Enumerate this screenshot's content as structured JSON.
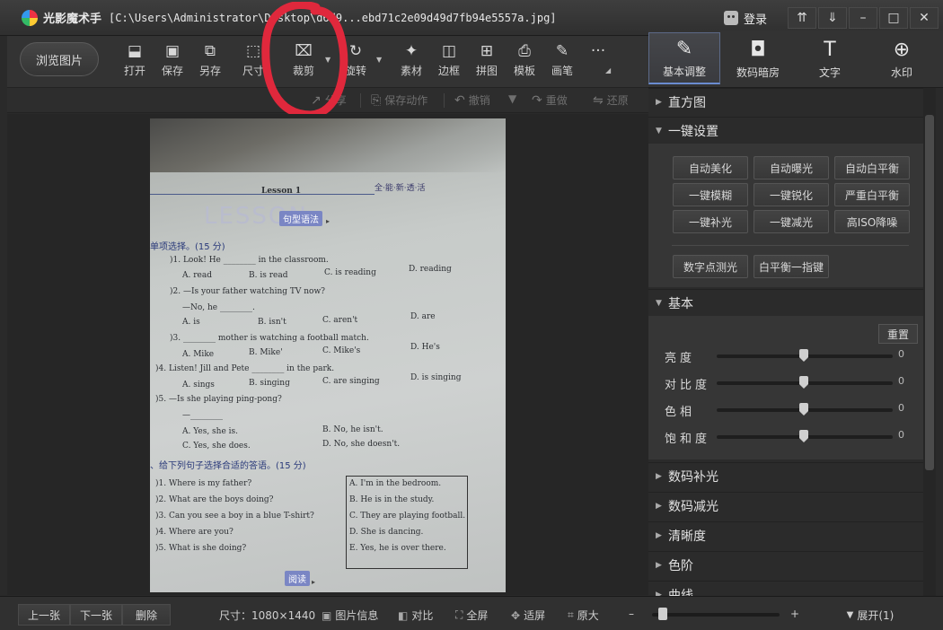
{
  "titlebar": {
    "app_name": "光影魔术手",
    "file_path": "[C:\\Users\\Administrator\\Desktop\\d6d9...ebd71c2e09d49d7fb94e5557a.jpg]",
    "login_label": "登录",
    "window_buttons": [
      "⇈",
      "⇓",
      "–",
      "□",
      "✕"
    ]
  },
  "toolbar": {
    "browse_label": "浏览图片",
    "tools": [
      {
        "label": "打开",
        "icon": "open-icon",
        "glyph": "⬓"
      },
      {
        "label": "保存",
        "icon": "save-icon",
        "glyph": "▣"
      },
      {
        "label": "另存",
        "icon": "save-as-icon",
        "glyph": "⧉"
      },
      {
        "label": "尺寸",
        "icon": "resize-icon",
        "glyph": "⬚"
      },
      {
        "label": "裁剪",
        "icon": "crop-icon",
        "glyph": "⌧"
      },
      {
        "label": "旋转",
        "icon": "rotate-icon",
        "glyph": "↻"
      },
      {
        "label": "素材",
        "icon": "material-icon",
        "glyph": "✦"
      },
      {
        "label": "边框",
        "icon": "border-icon",
        "glyph": "◫"
      },
      {
        "label": "拼图",
        "icon": "collage-icon",
        "glyph": "⊞"
      },
      {
        "label": "模板",
        "icon": "template-icon",
        "glyph": "⎙"
      },
      {
        "label": "画笔",
        "icon": "brush-icon",
        "glyph": "✎"
      },
      {
        "label": "",
        "icon": "more-icon",
        "glyph": "···"
      }
    ],
    "annotation_color": "#e0283c"
  },
  "actionbar": {
    "share": "分享",
    "save_action": "保存动作",
    "undo": "撤销",
    "redo": "重做",
    "restore": "还原"
  },
  "photo": {
    "lesson": "Lesson 1",
    "series": "全·能·新·透·活",
    "grammar_badge": "句型语法",
    "watermark": "LESSON",
    "part1": "单项选择。(15 分)",
    "q1": ")1. Look! He ________ in the classroom.",
    "q1_opts": [
      "A. read",
      "B. is read",
      "C. is reading",
      "D. reading"
    ],
    "q2": ")2. —Is your father watching TV now?",
    "q2b": "—No, he ________.",
    "q2_opts": [
      "A. is",
      "B. isn't",
      "C. aren't",
      "D. are"
    ],
    "q3": ")3. ________ mother is watching a football match.",
    "q3_opts": [
      "A. Mike",
      "B. Mike'",
      "C. Mike's",
      "D. He's"
    ],
    "q4": ")4. Listen! Jill and Pete ________ in the park.",
    "q4_opts": [
      "A. sings",
      "B. singing",
      "C. are singing",
      "D. is singing"
    ],
    "q5": ")5. —Is she playing ping-pong?",
    "q5b": "—________",
    "q5_opts": [
      "A. Yes, she is.",
      "B. No, he isn't.",
      "C. Yes, she does.",
      "D. No, she doesn't."
    ],
    "part2": "、给下列句子选择合适的答语。(15 分)",
    "m_questions": [
      ")1. Where is my father?",
      ")2. What are the boys doing?",
      ")3. Can you see a boy in a blue T-shirt?",
      ")4. Where are you?",
      ")5. What is she doing?"
    ],
    "m_answers": [
      "A. I'm in the bedroom.",
      "B. He is in the study.",
      "C. They are playing football.",
      "D. She is dancing.",
      "E. Yes, he is over there."
    ],
    "reading_badge": "阅读"
  },
  "right_tabs": [
    {
      "label": "基本调整",
      "icon": "basic-adjust-icon",
      "glyph": "✎"
    },
    {
      "label": "数码暗房",
      "icon": "darkroom-icon",
      "glyph": "◘"
    },
    {
      "label": "文字",
      "icon": "text-icon",
      "glyph": "T"
    },
    {
      "label": "水印",
      "icon": "watermark-icon",
      "glyph": "⊕"
    }
  ],
  "right_panel": {
    "histogram": "直方图",
    "one_click": "一键设置",
    "quick_buttons": [
      "自动美化",
      "自动曝光",
      "自动白平衡",
      "一键模糊",
      "一键锐化",
      "严重白平衡",
      "一键补光",
      "一键减光",
      "高ISO降噪"
    ],
    "digital_metering": "数字点测光",
    "white_balance_finger": "白平衡一指键",
    "basic": "基本",
    "reset": "重置",
    "sliders": [
      {
        "label": "亮度",
        "value": "0"
      },
      {
        "label": "对比度",
        "value": "0"
      },
      {
        "label": "色相",
        "value": "0"
      },
      {
        "label": "饱和度",
        "value": "0"
      }
    ],
    "sections": [
      "数码补光",
      "数码减光",
      "清晰度",
      "色阶",
      "曲线"
    ]
  },
  "statusbar": {
    "prev": "上一张",
    "next": "下一张",
    "delete": "删除",
    "size": "尺寸：1080×1440",
    "info": "图片信息",
    "compare": "对比",
    "fullscreen": "全屏",
    "fit": "适屏",
    "original": "原大",
    "zoom_minus": "–",
    "zoom_plus": "+",
    "expand": "展开(1)"
  }
}
